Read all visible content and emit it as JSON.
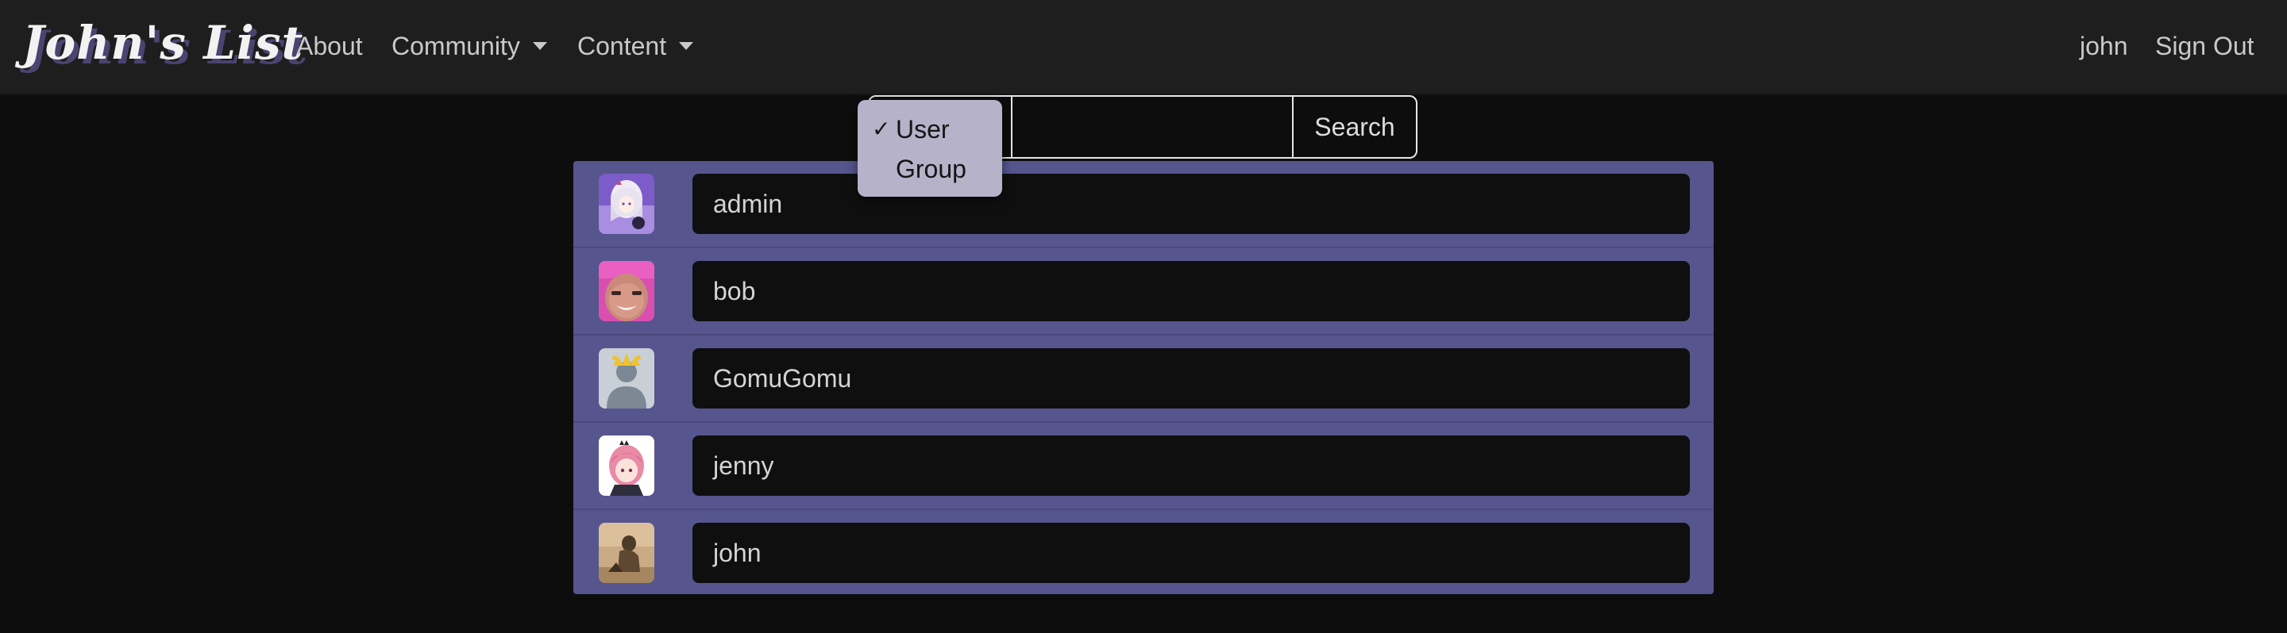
{
  "navbar": {
    "brand": "John's List",
    "links": [
      {
        "label": "About",
        "has_dropdown": false
      },
      {
        "label": "Community",
        "has_dropdown": true
      },
      {
        "label": "Content",
        "has_dropdown": true
      }
    ],
    "right": [
      {
        "label": "john"
      },
      {
        "label": "Sign Out"
      }
    ]
  },
  "search": {
    "type_options": [
      {
        "label": "User",
        "selected": true
      },
      {
        "label": "Group",
        "selected": false
      }
    ],
    "check_mark": "✓",
    "query": "",
    "button_label": "Search"
  },
  "users": [
    {
      "name": "admin",
      "avatar": "anime-girl-silver-hair"
    },
    {
      "name": "bob",
      "avatar": "man-pink-face"
    },
    {
      "name": "GomuGomu",
      "avatar": "default-silhouette"
    },
    {
      "name": "jenny",
      "avatar": "anime-pink-hair"
    },
    {
      "name": "john",
      "avatar": "seated-figure-photo"
    }
  ],
  "colors": {
    "page_bg": "#0d0d0d",
    "navbar_bg": "#1e1e1e",
    "list_bg": "#56558d",
    "name_box_bg": "#0f0f0f",
    "dropdown_bg": "#b5b2c9"
  }
}
